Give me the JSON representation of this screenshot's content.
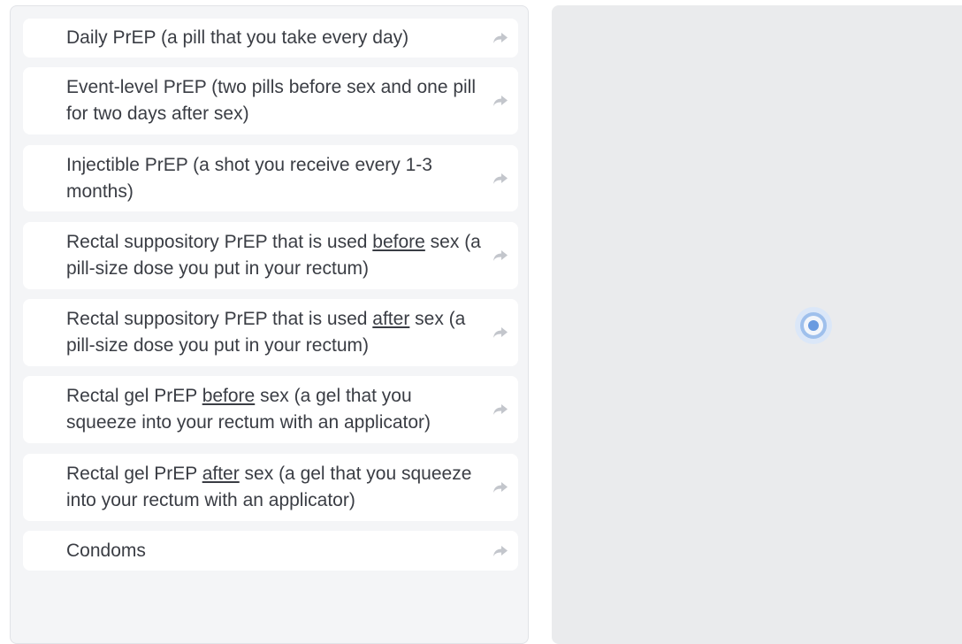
{
  "choices": [
    {
      "parts": [
        {
          "text": "Daily PrEP (a pill that you take every day)"
        }
      ]
    },
    {
      "parts": [
        {
          "text": "Event-level PrEP (two pills before sex and one pill for two days after sex)"
        }
      ]
    },
    {
      "parts": [
        {
          "text": "Injectible PrEP (a shot you receive every 1-3 months)"
        }
      ]
    },
    {
      "parts": [
        {
          "text": "Rectal suppository PrEP that is used "
        },
        {
          "text": "before",
          "underline": true
        },
        {
          "text": " sex (a pill-size dose you put in your rectum)"
        }
      ]
    },
    {
      "parts": [
        {
          "text": "Rectal suppository PrEP that is used "
        },
        {
          "text": "after",
          "underline": true
        },
        {
          "text": " sex (a pill-size dose you put in your rectum)"
        }
      ]
    },
    {
      "parts": [
        {
          "text": "Rectal gel PrEP "
        },
        {
          "text": "before",
          "underline": true
        },
        {
          "text": " sex (a gel that you squeeze into your rectum with an applicator)"
        }
      ]
    },
    {
      "parts": [
        {
          "text": "Rectal gel PrEP "
        },
        {
          "text": "after",
          "underline": true
        },
        {
          "text": " sex (a gel that you squeeze into your rectum with an applicator)"
        }
      ]
    },
    {
      "parts": [
        {
          "text": "Condoms"
        }
      ]
    }
  ],
  "icons": {
    "choice_arrow": "share-arrow-icon",
    "loader": "loading-spinner-icon"
  },
  "colors": {
    "left_panel_bg": "#f4f5f7",
    "right_panel_bg": "#eaebed",
    "choice_bg": "#ffffff",
    "text": "#3a3d44",
    "arrow": "#c3c6cc",
    "spinner": "#6a9be0"
  }
}
